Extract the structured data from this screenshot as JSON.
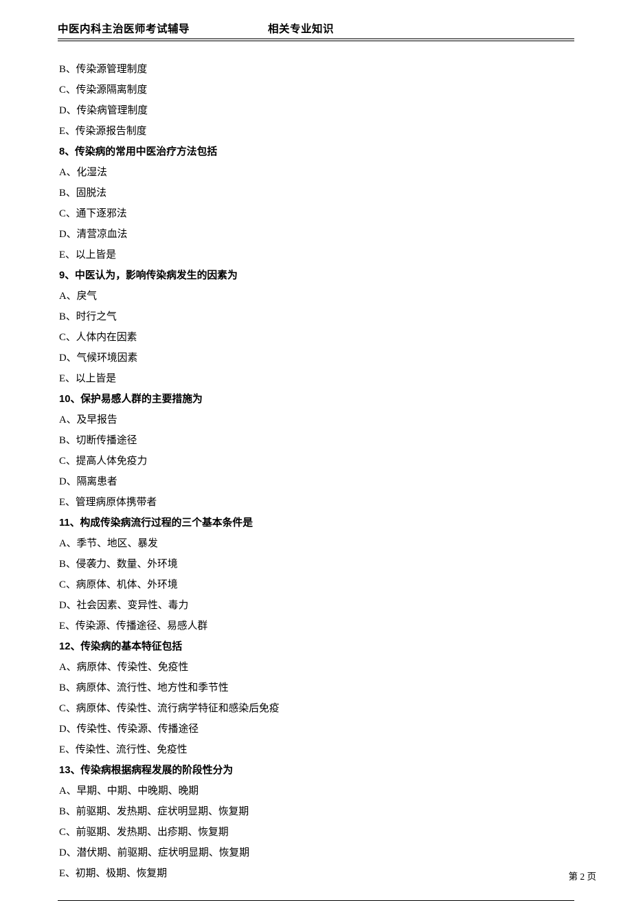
{
  "header": {
    "left": "中医内科主治医师考试辅导",
    "right": "相关专业知识"
  },
  "orphan_options": [
    "B、传染源管理制度",
    "C、传染源隔离制度",
    "D、传染病管理制度",
    "E、传染源报告制度"
  ],
  "questions": [
    {
      "stem": "8、传染病的常用中医治疗方法包括",
      "options": [
        "A、化湿法",
        "B、固脱法",
        "C、通下逐邪法",
        "D、清营凉血法",
        "E、以上皆是"
      ]
    },
    {
      "stem": "9、中医认为，影响传染病发生的因素为",
      "options": [
        "A、戾气",
        "B、时行之气",
        "C、人体内在因素",
        "D、气候环境因素",
        "E、以上皆是"
      ]
    },
    {
      "stem": "10、保护易感人群的主要措施为",
      "options": [
        "A、及早报告",
        "B、切断传播途径",
        "C、提高人体免疫力",
        "D、隔离患者",
        "E、管理病原体携带者"
      ]
    },
    {
      "stem": "11、构成传染病流行过程的三个基本条件是",
      "options": [
        "A、季节、地区、暴发",
        "B、侵袭力、数量、外环境",
        "C、病原体、机体、外环境",
        "D、社会因素、变异性、毒力",
        "E、传染源、传播途径、易感人群"
      ]
    },
    {
      "stem": "12、传染病的基本特征包括",
      "options": [
        "A、病原体、传染性、免疫性",
        "B、病原体、流行性、地方性和季节性",
        "C、病原体、传染性、流行病学特征和感染后免疫",
        "D、传染性、传染源、传播途径",
        "E、传染性、流行性、免疫性"
      ]
    },
    {
      "stem": "13、传染病根据病程发展的阶段性分为",
      "options": [
        "A、早期、中期、中晚期、晚期",
        "B、前驱期、发热期、症状明显期、恢复期",
        "C、前驱期、发热期、出疹期、恢复期",
        "D、潜伏期、前驱期、症状明显期、恢复期",
        "E、初期、极期、恢复期"
      ]
    }
  ],
  "footer": {
    "page": "第 2 页"
  }
}
